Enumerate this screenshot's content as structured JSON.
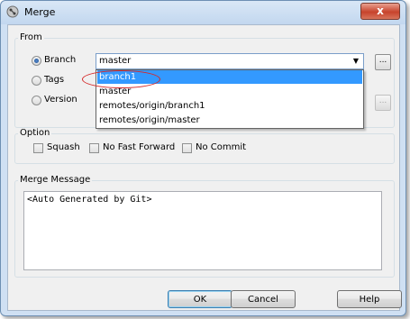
{
  "window": {
    "title": "Merge",
    "close_label": "x"
  },
  "from": {
    "label": "From",
    "branch_label": "Branch",
    "tags_label": "Tags",
    "version_label": "Version",
    "branch_value": "master",
    "browse_label": "...",
    "dropdown_items": [
      "branch1",
      "master",
      "remotes/origin/branch1",
      "remotes/origin/master"
    ]
  },
  "option": {
    "label": "Option",
    "squash_label": "Squash",
    "no_fast_forward_label": "No Fast Forward",
    "no_commit_label": "No Commit"
  },
  "message": {
    "label": "Merge Message",
    "value": "<Auto Generated by Git>"
  },
  "buttons": {
    "ok": "OK",
    "cancel": "Cancel",
    "help": "Help"
  },
  "colors": {
    "selection": "#3399ff",
    "annotation": "#d52a2a"
  }
}
